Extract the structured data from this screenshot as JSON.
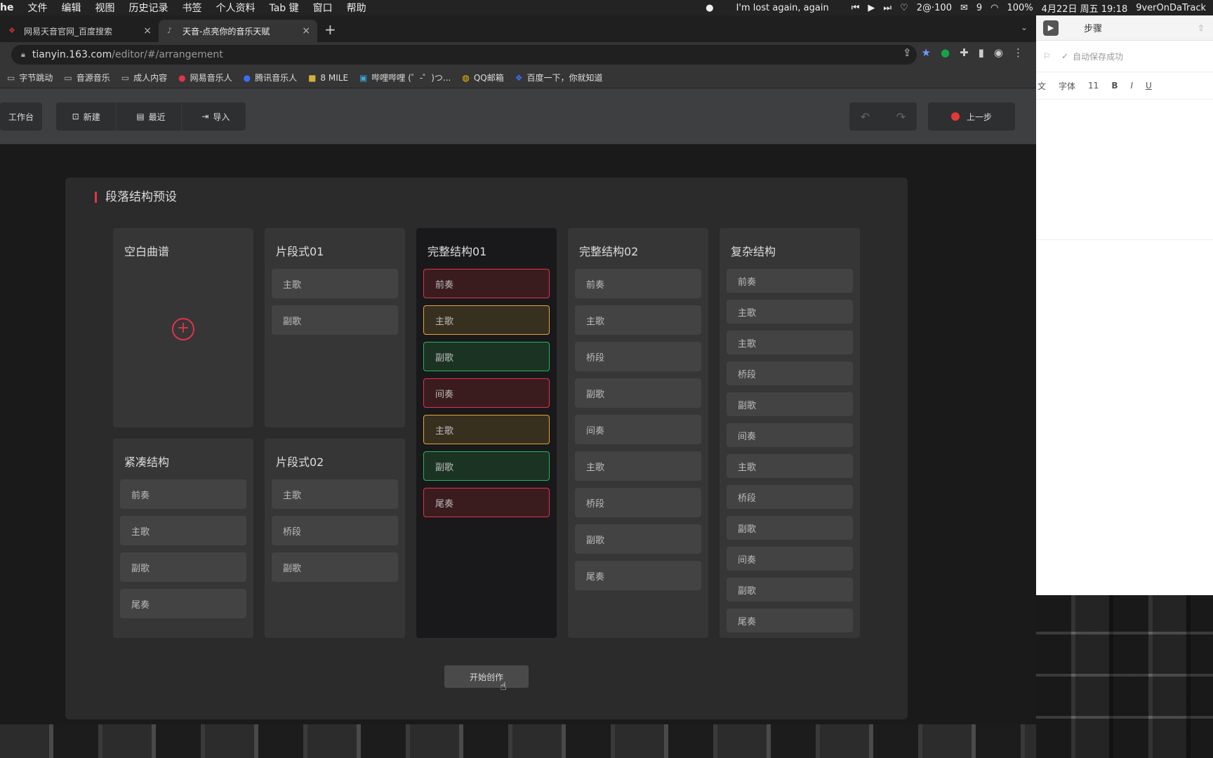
{
  "menubar": {
    "app_name": "he",
    "items": [
      "文件",
      "编辑",
      "视图",
      "历史记录",
      "书签",
      "个人资料",
      "Tab 键",
      "窗口",
      "帮助"
    ],
    "now_playing": "I'm lost again, again",
    "counter": "2@·100",
    "wechat_count": "9",
    "battery": "100%",
    "datetime": "4月22日 周五  19:18",
    "user": "9verOnDaTrack"
  },
  "browser": {
    "tabs": [
      {
        "title": "网易天音官网_百度搜索",
        "active": false
      },
      {
        "title": "天音-点亮你的音乐天赋",
        "active": true
      }
    ],
    "url_host": "tianyin.163.com",
    "url_path": "/editor/#/arrangement",
    "bookmarks": [
      "字节跳动",
      "音源音乐",
      "成人内容",
      "网易音乐人",
      "腾讯音乐人",
      "8 MILE",
      "哔哩哔哩 (゜-゜)つ...",
      "QQ邮箱",
      "百度一下，你就知道"
    ]
  },
  "toolbar": {
    "workspace": "工作台",
    "new": "新建",
    "recent": "最近",
    "import": "导入",
    "prev_step": "上一步"
  },
  "panel": {
    "title": "段落结构预设",
    "start_button": "开始创作",
    "cards": {
      "blank": {
        "title": "空白曲谱"
      },
      "fragment01": {
        "title": "片段式01",
        "segments": [
          "主歌",
          "副歌"
        ]
      },
      "full01": {
        "title": "完整结构01",
        "segments": [
          "前奏",
          "主歌",
          "副歌",
          "间奏",
          "主歌",
          "副歌",
          "尾奏"
        ]
      },
      "full02": {
        "title": "完整结构02",
        "segments": [
          "前奏",
          "主歌",
          "桥段",
          "副歌",
          "间奏",
          "主歌",
          "桥段",
          "副歌",
          "尾奏"
        ]
      },
      "complex": {
        "title": "复杂结构",
        "segments": [
          "前奏",
          "主歌",
          "主歌",
          "桥段",
          "副歌",
          "间奏",
          "主歌",
          "桥段",
          "副歌",
          "间奏",
          "副歌",
          "尾奏"
        ]
      },
      "compact": {
        "title": "紧凑结构",
        "segments": [
          "前奏",
          "主歌",
          "副歌",
          "尾奏"
        ]
      },
      "fragment02": {
        "title": "片段式02",
        "segments": [
          "主歌",
          "桥段",
          "副歌"
        ]
      }
    }
  },
  "doc_app": {
    "title": "步骤",
    "status": "自动保存成功",
    "format": {
      "lang": "文",
      "font": "字体",
      "size": "11",
      "bold": "B",
      "italic": "I",
      "underline": "U"
    }
  },
  "colors": {
    "accent_red": "#e0344a",
    "accent_orange": "#e4a33a",
    "accent_green": "#25b45a"
  }
}
